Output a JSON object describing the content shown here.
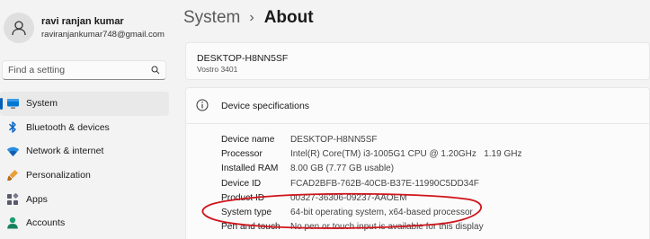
{
  "profile": {
    "name": "ravi ranjan kumar",
    "email": "raviranjankumar748@gmail.com"
  },
  "search": {
    "placeholder": "Find a setting"
  },
  "sidebar": {
    "items": [
      {
        "label": "System",
        "icon": "monitor-icon",
        "active": true
      },
      {
        "label": "Bluetooth & devices",
        "icon": "bluetooth-icon"
      },
      {
        "label": "Network & internet",
        "icon": "wifi-icon"
      },
      {
        "label": "Personalization",
        "icon": "paintbrush-icon"
      },
      {
        "label": "Apps",
        "icon": "apps-icon"
      },
      {
        "label": "Accounts",
        "icon": "person-icon"
      }
    ]
  },
  "breadcrumb": {
    "parent": "System",
    "separator": "›",
    "current": "About"
  },
  "device": {
    "name": "DESKTOP-H8NN5SF",
    "model": "Vostro 3401"
  },
  "specs": {
    "title": "Device specifications",
    "rows": [
      {
        "label": "Device name",
        "value": "DESKTOP-H8NN5SF"
      },
      {
        "label": "Processor",
        "value": "Intel(R) Core(TM) i3-1005G1 CPU @ 1.20GHz   1.19 GHz"
      },
      {
        "label": "Installed RAM",
        "value": "8.00 GB (7.77 GB usable)"
      },
      {
        "label": "Device ID",
        "value": "FCAD2BFB-762B-40CB-B37E-11990C5DD34F"
      },
      {
        "label": "Product ID",
        "value": "00327-36306-09237-AAOEM"
      },
      {
        "label": "System type",
        "value": "64-bit operating system, x64-based processor"
      },
      {
        "label": "Pen and touch",
        "value": "No pen or touch input is available for this display"
      }
    ]
  },
  "colors": {
    "accent": "#005fb8",
    "annotation": "#d0141b",
    "background": "#f3f3f3",
    "card": "#fbfbfb"
  }
}
